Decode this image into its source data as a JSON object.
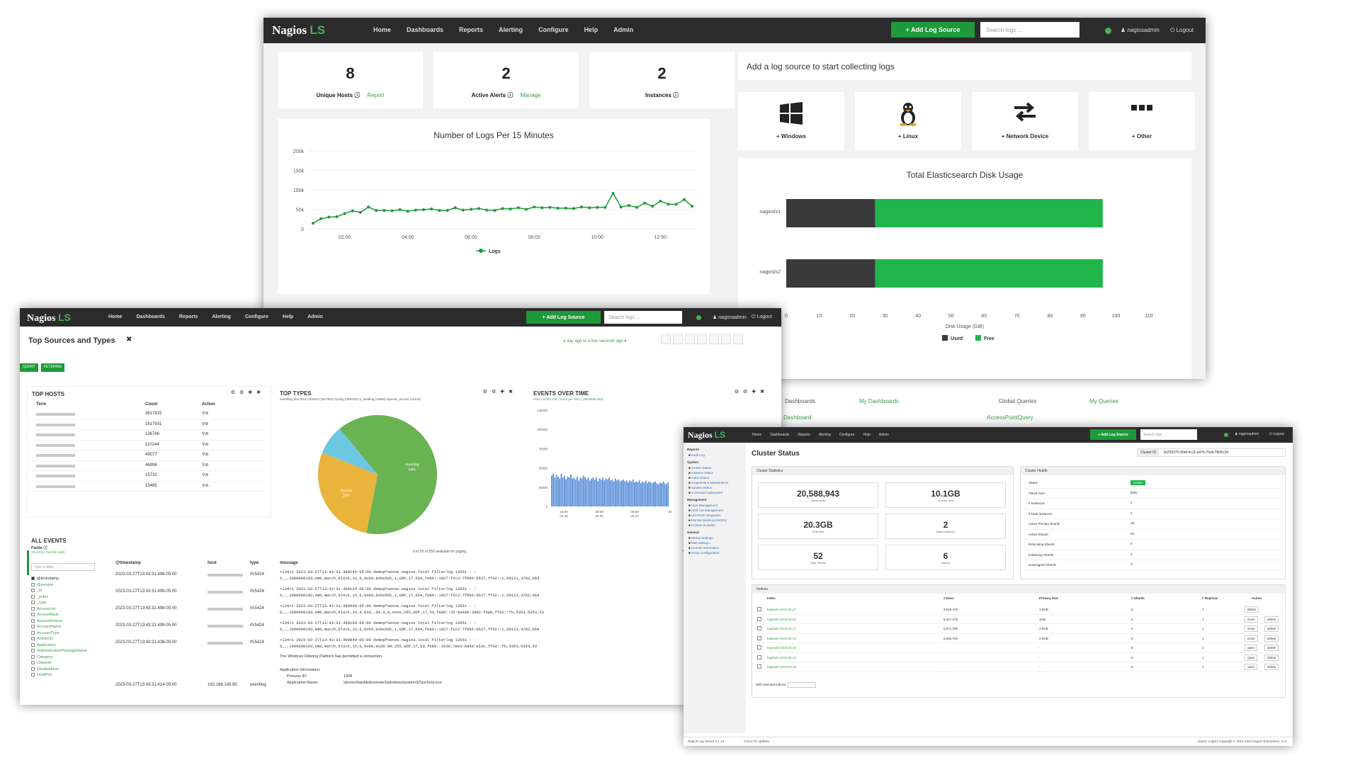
{
  "w1": {
    "nav": {
      "logo": "Nagios",
      "ls": "LS",
      "items": [
        "Home",
        "Dashboards",
        "Reports",
        "Alerting",
        "Configure",
        "Help",
        "Admin"
      ],
      "add": "+ Add Log Source",
      "search_ph": "Search logs ...",
      "user": "nagiosadmin",
      "logout": "Logout"
    },
    "stats": [
      {
        "num": "8",
        "label": "Unique Hosts",
        "link": "Report"
      },
      {
        "num": "2",
        "label": "Active Alerts",
        "link": "Manage"
      },
      {
        "num": "2",
        "label": "Instances",
        "link": ""
      }
    ],
    "add_title": "Add a log source to start collecting logs",
    "sources": [
      "+ Windows",
      "+ Linux",
      "+ Network Device",
      "+ Other"
    ],
    "disk_title": "Total Elasticsearch Disk Usage",
    "disk_legend": [
      "Used",
      "Free"
    ],
    "disk_xlabel": "Disk Usage (GiB)",
    "bottom_tabs": [
      "Dashboards",
      "My Dashboards",
      "Global Queries",
      "My Queries"
    ],
    "bottom_links": [
      "Dashboard",
      "AccessPointQuery"
    ],
    "colors": {
      "green": "#1fb54b",
      "dark": "#3a3a3a"
    }
  },
  "chart_data": [
    {
      "type": "line",
      "title": "Number of Logs Per 15 Minutes",
      "x": [
        "01:00",
        "01:15",
        "01:30",
        "01:45",
        "02:00",
        "02:15",
        "02:30",
        "02:45",
        "03:00",
        "03:15",
        "03:30",
        "03:45",
        "04:00",
        "04:15",
        "04:30",
        "04:45",
        "05:00",
        "05:15",
        "05:30",
        "05:45",
        "06:00",
        "06:15",
        "06:30",
        "06:45",
        "07:00",
        "07:15",
        "07:30",
        "07:45",
        "08:00",
        "08:15",
        "08:30",
        "08:45",
        "09:00",
        "09:15",
        "09:30",
        "09:45",
        "10:00",
        "10:15",
        "10:30",
        "10:45",
        "11:00",
        "11:15",
        "11:30",
        "11:45",
        "12:00",
        "12:15",
        "12:30",
        "12:45",
        "13:00"
      ],
      "series": [
        {
          "name": "Logs",
          "values": [
            14000,
            26000,
            30000,
            31000,
            39000,
            46000,
            42000,
            56000,
            47000,
            47000,
            46000,
            49000,
            45000,
            48000,
            49000,
            51000,
            47000,
            47000,
            54000,
            48000,
            50000,
            52000,
            48000,
            47000,
            52000,
            51000,
            54000,
            50000,
            56000,
            54000,
            55000,
            53000,
            53000,
            52000,
            56000,
            54000,
            55000,
            55000,
            91000,
            56000,
            60000,
            55000,
            66000,
            58000,
            71000,
            63000,
            63000,
            75000,
            58000
          ]
        }
      ],
      "xticks": [
        "02:00",
        "04:00",
        "06:00",
        "08:00",
        "10:00",
        "12:00"
      ],
      "yticks": [
        "0",
        "50k",
        "100k",
        "150k",
        "200k"
      ],
      "ylim": [
        0,
        200000
      ]
    },
    {
      "type": "bar",
      "orientation": "horizontal",
      "title": "Total Elasticsearch Disk Usage",
      "categories": [
        "nagiosls1",
        "nagiosls2"
      ],
      "series": [
        {
          "name": "Used",
          "values": [
            27,
            27
          ]
        },
        {
          "name": "Free",
          "values": [
            69,
            69
          ]
        }
      ],
      "xticks": [
        "0",
        "10",
        "20",
        "30",
        "40",
        "50",
        "60",
        "70",
        "80",
        "90",
        "100",
        "110"
      ],
      "xlabel": "Disk Usage (GiB)",
      "xlim": [
        0,
        110
      ]
    },
    {
      "type": "pie",
      "title": "TOP TYPES",
      "categories": [
        "eventlog",
        "rfc5424",
        "syslog"
      ],
      "values": [
        64,
        28,
        8
      ],
      "slice_labels": [
        "eventlog 64%",
        "rfc5424 28%",
        ""
      ]
    }
  ],
  "w2": {
    "nav": {
      "logo": "Nagios",
      "ls": "LS",
      "items": [
        "Home",
        "Dashboards",
        "Reports",
        "Alerting",
        "Configure",
        "Help",
        "Admin"
      ],
      "add": "+ Add Log Source",
      "search_ph": "Search logs ...",
      "user": "nagiosadmin",
      "logout": "Logout"
    },
    "title": "Top Sources and Types",
    "timeframe": "a day ago to a few seconds ago",
    "query_tags": [
      "QUERY",
      "FILTERING"
    ],
    "top_hosts": {
      "title": "TOP HOSTS",
      "cols": [
        "Term",
        "Count",
        "Action"
      ],
      "counts": [
        "3617815",
        "1617931",
        "136786",
        "110244",
        "49077",
        "46996",
        "15732",
        "15485"
      ]
    },
    "top_types_title": "TOP TYPES",
    "top_types_legend": "eventlog (3617815) rfc5424 (1617931) syslog (359793) ui_auditlog (19984) apache_access (14144)",
    "events_title": "EVENTS OVER TIME",
    "events_sub": "View | Zoom Out | count per 10m | (3619666 hits)",
    "events_yticks": [
      "125000",
      "100000",
      "75000",
      "50000",
      "25000",
      "0"
    ],
    "events_xticks": [
      "16:00 03-26",
      "20:00 03-26",
      "00:00 03-27",
      "04"
    ],
    "all_events": {
      "title": "ALL EVENTS",
      "fields": "Fields",
      "fields_sub": "All (371) / Current (164)",
      "filter_ph": "Type to filter...",
      "paging": "0 to 50 of 250 available for paging",
      "cols": [
        "@timestamp",
        "host",
        "type",
        "message"
      ],
      "fields_list": [
        "@timestamp",
        "@version",
        "_id",
        "_index",
        "_type",
        "AccessList",
        "AccessMask",
        "AccessReason",
        "AccountName",
        "AccountType",
        "ActivityID",
        "Application",
        "AuthenticationPackageName",
        "Category",
        "Channel",
        "DestAddress",
        "DestPort"
      ],
      "rows": [
        {
          "ts": "2023-03-27T13:43:31.499-05:00",
          "type": "rfc5424",
          "m1": "<134>1 2023-03-27T13:43:31.499145-05:00 demopfsense.nagios.local filterlog 13561 - -",
          "m2": "6,,,1000000103,em0,match,block,in,6,0x00,0xbe5d1,1,UDP,17,664,fe80::1827:f2c2:7f8b6:b627,ff02::c,60121,3702,664"
        },
        {
          "ts": "2023-03-27T13:43:31.499-05:00",
          "type": "rfc5424",
          "m1": "<134>1 2023-03-27T13:43:31.499124-05:00 demopfsense.nagios.local filterlog 13561 - -",
          "m2": "6,,,1000000103,em0,match,block,in,6,0x00,0xbe5d1,1,UDP,17,664,fe80::1827:f2c2:7f8b6:b627,ff02::c,60121,3702,664"
        },
        {
          "ts": "2023-03-27T13:43:31.499-05:00",
          "type": "rfc5424",
          "m1": "<134>1 2023-03-27T13:43:31.499068-05:00 demopfsense.nagios.local filterlog 13561 - -",
          "m2": "6,,,1000000103,em0,match,block,in,4,0x0,,64,0,0,none,255,UDP,17,53,fe80::25:8a489:3dd2:f6ab,ff02::fb,5353,5353,53"
        },
        {
          "ts": "2023-03-27T13:43:31.499-05:00",
          "type": "rfc5424",
          "m1": "<134>1 2023-03-27T13:43:31.499100-05:00 demopfsense.nagios.local filterlog 13561 - -",
          "m2": "6,,,1000000103,em0,match,block,in,6,0x00,0xbe5d1,1,UDP,17,664,fe80::1827:f2c2:7f8b6:b627,ff02::c,60121,3702,664"
        },
        {
          "ts": "2023-03-27T13:43:31.438-05:00",
          "type": "rfc5424",
          "m1": "<134>1 2023-03-27T13:43:31.499849-05:00 demopfsense.nagios.local filterlog 13561 - -",
          "m2": "6,,,1000000103,em0,match,block,in,6,0x00,0x30:00,255,UDP,17,53,fe80::1036:10e3:bd40:e53c,ff02::fb,5353,5353,53"
        }
      ],
      "last_row": {
        "ts": "2023-03-27T13:43:31.414-05:00",
        "host": "192.168.145.90",
        "type": "eventlog",
        "m1": "The Windows Filtering Platform has permitted a connection.",
        "m2": "Application Information:",
        "m3": "Process ID:",
        "m3v": "1308",
        "m4": "Application Name:",
        "m4v": "\\device\\harddiskvolume2\\windows\\system32\\svchost.exe"
      }
    }
  },
  "w3": {
    "nav": {
      "logo": "Nagios",
      "ls": "LS",
      "items": [
        "Home",
        "Dashboards",
        "Reports",
        "Alerting",
        "Configure",
        "Help",
        "Admin"
      ],
      "add": "+ Add Log Source",
      "search_ph": "Search logs ...",
      "user": "nagiosadmin",
      "logout": "Logout"
    },
    "title": "Cluster Status",
    "cluster_id_label": "Cluster ID",
    "cluster_id": "3e255375-90df-4c11-a47b-75afc78b8c3d",
    "sidebar": {
      "sections": [
        {
          "title": "Reports",
          "items": [
            "Audit Log"
          ]
        },
        {
          "title": "System",
          "items": [
            "Cluster Status",
            "Instance Status",
            "Index Status",
            "Snapshots & Maintenance",
            "System Status",
            "Command Subsystem"
          ]
        },
        {
          "title": "Management",
          "items": [
            "User Management",
            "Host List Management",
            "LDAP/AD Integration",
            "Monitor Backend (NCPA)",
            "Custom Includes"
          ]
        },
        {
          "title": "General",
          "items": [
            "Global Settings",
            "Mail Settings",
            "License Information",
            "Proxy Configuration"
          ]
        }
      ]
    },
    "stats_title": "Cluster Statistics",
    "stats": [
      {
        "num": "20,588,943",
        "lbl": "Documents"
      },
      {
        "num": "10.1GB",
        "lbl": "Primary Size"
      },
      {
        "num": "20.3GB",
        "lbl": "Total Size"
      },
      {
        "num": "2",
        "lbl": "Data Instances"
      },
      {
        "num": "52",
        "lbl": "Total Shards"
      },
      {
        "num": "6",
        "lbl": "Indices"
      }
    ],
    "health_title": "Cluster Health",
    "health": [
      {
        "k": "Status",
        "v": "Green"
      },
      {
        "k": "Timed Out?",
        "v": "false"
      },
      {
        "k": "# Instances",
        "v": "2"
      },
      {
        "k": "# Data Instances",
        "v": "2"
      },
      {
        "k": "Active Primary Shards",
        "v": "26"
      },
      {
        "k": "Active Shards",
        "v": "52"
      },
      {
        "k": "Relocating Shards",
        "v": "0"
      },
      {
        "k": "Initializing Shards",
        "v": "0"
      },
      {
        "k": "Unassigned Shards",
        "v": "0"
      }
    ],
    "indices_title": "Indices",
    "indices_cols": [
      "Index",
      "# Docs",
      "Primary Size",
      "# Shards",
      "# Replicas",
      "Action"
    ],
    "indices": [
      {
        "name": "logstash-2023.03.27",
        "docs": "2,019,475",
        "size": "1.5GB",
        "shards": "5",
        "rep": "1",
        "act": "delete"
      },
      {
        "name": "logstash-2023.03.26",
        "docs": "5,017,475",
        "size": "3GB",
        "shards": "5",
        "rep": "1",
        "act": "close"
      },
      {
        "name": "logstash-2023.03.17",
        "docs": "5,671,756",
        "size": "3.0GB",
        "shards": "5",
        "rep": "1",
        "act": "close"
      },
      {
        "name": "logstash-2023.03.16",
        "docs": "5,666,762",
        "size": "2.6GB",
        "shards": "5",
        "rep": "1",
        "act": "close"
      },
      {
        "name": "logstash-2023.03.15",
        "docs": "-",
        "size": "-",
        "shards": "5",
        "rep": "1",
        "act": "open"
      },
      {
        "name": "logstash-2023.03.14",
        "docs": "-",
        "size": "-",
        "shards": "5",
        "rep": "1",
        "act": "open"
      },
      {
        "name": "logstash-2023.03.13",
        "docs": "-",
        "size": "-",
        "shards": "5",
        "rep": "1",
        "act": "open"
      }
    ],
    "with_selected": "With selected indices:",
    "footer_left": "Nagios Log Server 2.1.13",
    "footer_update": "Check for updates",
    "footer_right": "About  |  Legal  |  Copyright © 2014-2023 Nagios Enterprises, LLC"
  }
}
